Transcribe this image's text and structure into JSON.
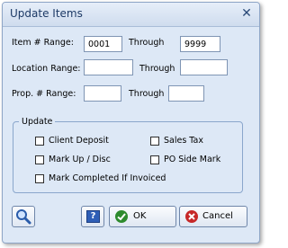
{
  "window": {
    "title": "Update Items",
    "close_glyph": "✕"
  },
  "form": {
    "item_range_label": "Item # Range:",
    "item_from": "0001",
    "item_through_label": "Through",
    "item_to": "9999",
    "location_range_label": "Location Range:",
    "location_from": "",
    "location_through_label": "Through",
    "location_to": "",
    "prop_range_label": "Prop. # Range:",
    "prop_from": "",
    "prop_through_label": "Through",
    "prop_to": ""
  },
  "update_group": {
    "legend": "Update",
    "options": [
      {
        "label": "Client Deposit",
        "checked": false
      },
      {
        "label": "Sales Tax",
        "checked": false
      },
      {
        "label": "Mark Up / Disc",
        "checked": false
      },
      {
        "label": "PO Side Mark",
        "checked": false
      },
      {
        "label": "Mark Completed If Invoiced",
        "checked": false
      }
    ]
  },
  "buttons": {
    "search_icon": "magnifier-icon",
    "help_label": "?",
    "ok_label": "OK",
    "cancel_label": "Cancel"
  },
  "colors": {
    "dialog_bg": "#dde8f6",
    "ok_check": "#2e8b2e",
    "cancel_x": "#c62828",
    "help_bg": "#2f5fb7"
  }
}
